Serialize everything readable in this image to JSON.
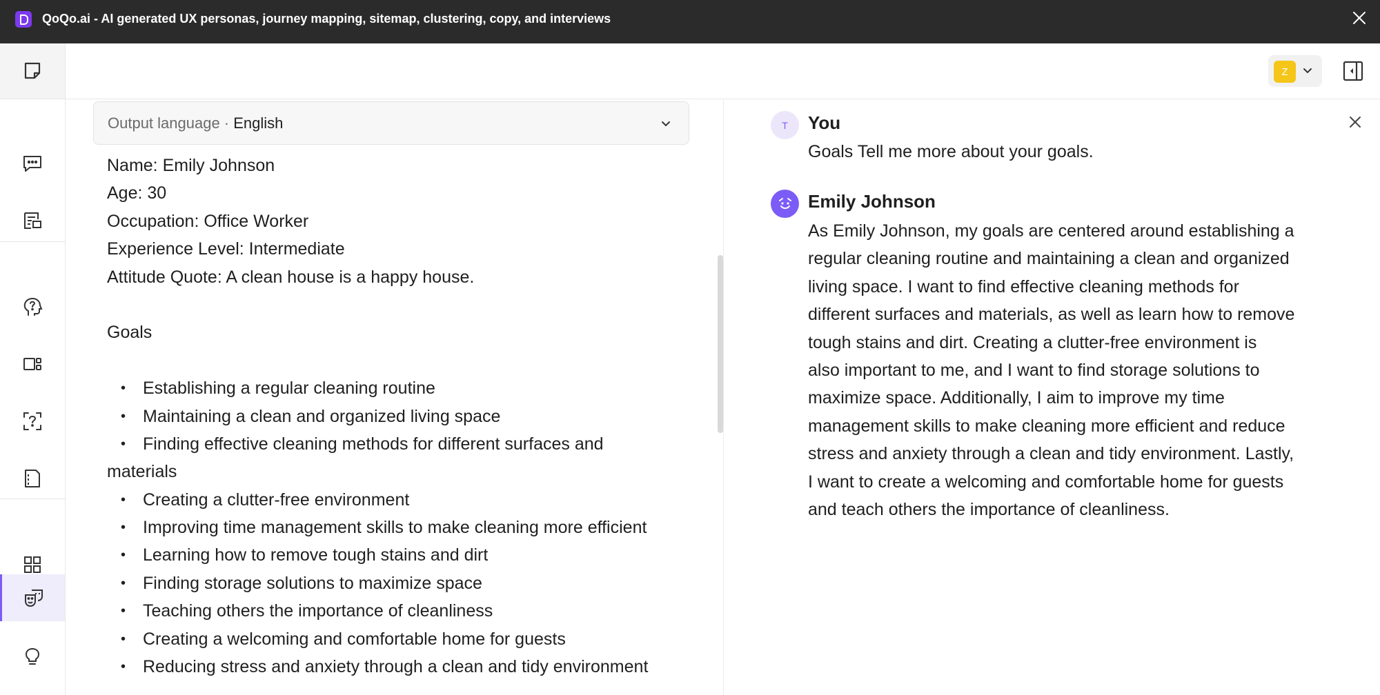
{
  "window": {
    "title": "QoQo.ai - AI generated UX personas, journey mapping, sitemap, clustering, copy, and interviews"
  },
  "sidebar": {
    "items": [
      {
        "name": "new-note-icon"
      },
      {
        "name": "chat-icon"
      },
      {
        "name": "document-list-icon"
      },
      {
        "name": "question-head-icon"
      },
      {
        "name": "layout-icon"
      },
      {
        "name": "question-frame-icon"
      },
      {
        "name": "document-icon"
      },
      {
        "name": "grid-icon"
      },
      {
        "name": "persona-masks-icon",
        "active": true
      },
      {
        "name": "lightbulb-icon"
      }
    ]
  },
  "header": {
    "user_initial": "Z"
  },
  "output_language": {
    "label": "Output language · ",
    "value": "English"
  },
  "persona": {
    "name": "Name: Emily Johnson",
    "age": "Age: 30",
    "occupation": "Occupation: Office Worker",
    "experience": "Experience Level: Intermediate",
    "quote": "Attitude Quote: A clean house is a happy house.",
    "goals_heading": "Goals",
    "goals": [
      "Establishing a regular cleaning routine",
      "Maintaining a clean and organized living space",
      "Finding effective cleaning methods for different surfaces and",
      "materials",
      "Creating a clutter-free environment",
      "Improving time management skills to make cleaning more efficient",
      "Learning how to remove tough stains and dirt",
      "Finding storage solutions to maximize space",
      "Teaching others the importance of cleanliness",
      "Creating a welcoming and comfortable home for guests",
      "Reducing stress and anxiety through a clean and tidy environment"
    ]
  },
  "chat": {
    "user_avatar_initial": "T",
    "user_name": "You",
    "user_message": "Goals Tell me more about your goals.",
    "persona_name": "Emily Johnson",
    "persona_message_lines": [
      "As Emily Johnson, my goals are centered around establishing a",
      "regular cleaning routine and maintaining a clean and organized",
      "living space. I want to find effective cleaning methods for",
      "different surfaces and materials, as well as learn how to remove",
      "tough stains and dirt. Creating a clutter-free environment is",
      "also important to me, and I want to find storage solutions to",
      "maximize space. Additionally, I aim to improve my time",
      "management skills to make cleaning more efficient and reduce",
      "stress and anxiety through a clean and tidy environment. Lastly,",
      "I want to create a welcoming and comfortable home for guests",
      "and teach others the importance of cleanliness."
    ]
  },
  "colors": {
    "titlebar": "#2b2b2b",
    "accent": "#7c5cf6",
    "user_avatar": "#f5c518"
  }
}
